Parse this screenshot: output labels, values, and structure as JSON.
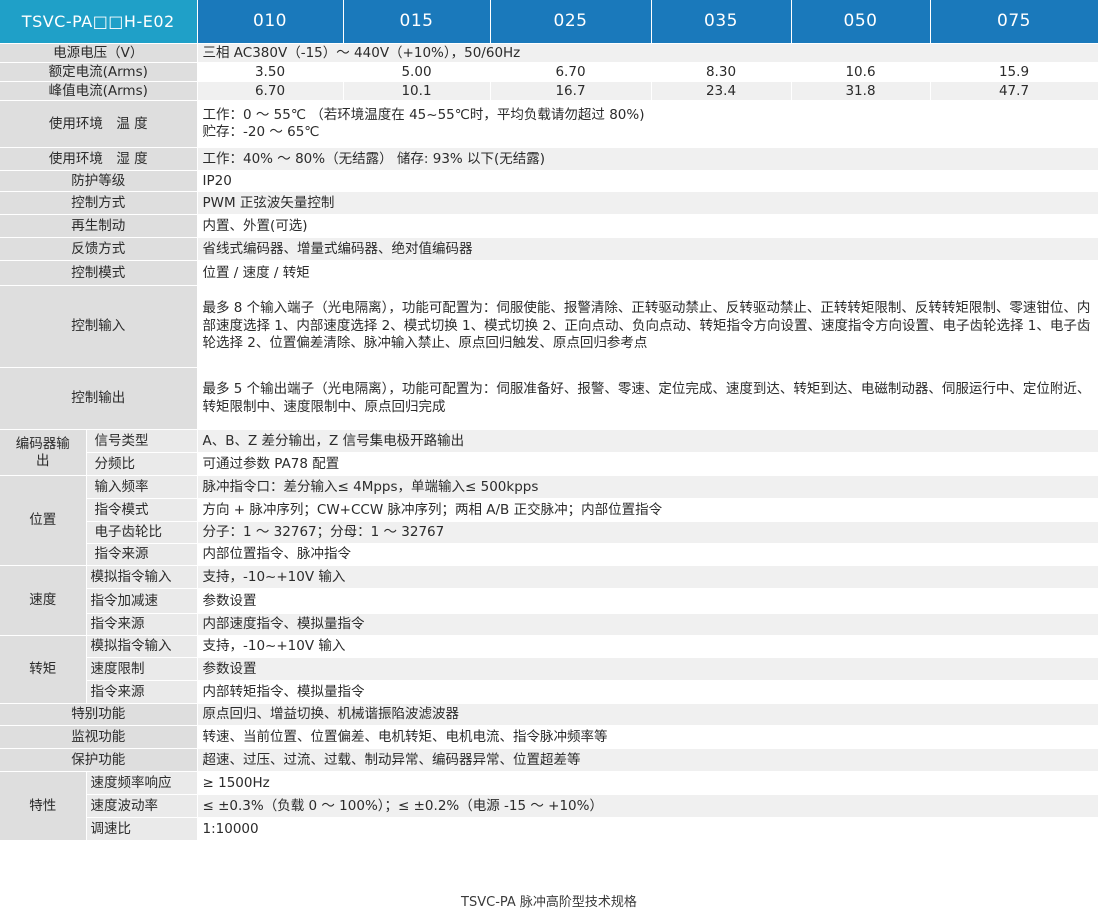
{
  "header": {
    "model": "TSVC-PA□□H-E02",
    "columns": [
      "010",
      "015",
      "025",
      "035",
      "050",
      "075"
    ]
  },
  "rows": {
    "voltage": {
      "label": "电源电压（V）",
      "value": "三相 AC380V（-15）～ 440V（+10%），50/60Hz"
    },
    "rated": {
      "label": "额定电流(Arms)",
      "values": [
        "3.50",
        "5.00",
        "6.70",
        "8.30",
        "10.6",
        "15.9"
      ]
    },
    "peak": {
      "label": "峰值电流(Arms)",
      "values": [
        "6.70",
        "10.1",
        "16.7",
        "23.4",
        "31.8",
        "47.7"
      ]
    },
    "temp": {
      "label": "使用环境　温 度",
      "line1": "工作：0 ～ 55℃ （若环境温度在 45~55℃时，平均负载请勿超过 80%)",
      "line2": "贮存：-20 ～ 65℃"
    },
    "humidity": {
      "label": "使用环境　湿 度",
      "value": "工作：40% ～ 80%（无结露） 储存: 93% 以下(无结露)"
    },
    "protection_class": {
      "label": "防护等级",
      "value": "IP20"
    },
    "control_method": {
      "label": "控制方式",
      "value": "PWM 正弦波矢量控制"
    },
    "regen": {
      "label": "再生制动",
      "value": "内置、外置(可选)"
    },
    "feedback": {
      "label": "反馈方式",
      "value": "省线式编码器、增量式编码器、绝对值编码器"
    },
    "control_mode": {
      "label": "控制模式",
      "value": "位置 / 速度 / 转矩"
    },
    "control_input": {
      "label": "控制输入",
      "value": "最多 8 个输入端子（光电隔离），功能可配置为：伺服使能、报警清除、正转驱动禁止、反转驱动禁止、正转转矩限制、反转转矩限制、零速钳位、内部速度选择 1、内部速度选择 2、模式切换 1、模式切换 2、正向点动、负向点动、转矩指令方向设置、速度指令方向设置、电子齿轮选择 1、电子齿轮选择 2、位置偏差清除、脉冲输入禁止、原点回归触发、原点回归参考点"
    },
    "control_output": {
      "label": "控制输出",
      "value": "最多 5 个输出端子（光电隔离），功能可配置为：伺服准备好、报警、零速、定位完成、速度到达、转矩到达、电磁制动器、伺服运行中、定位附近、转矩限制中、速度限制中、原点回归完成"
    },
    "encoder_out": {
      "group": "编码器输出",
      "signal": {
        "label": "信号类型",
        "value": "A、B、Z 差分输出，Z 信号集电极开路输出"
      },
      "divider": {
        "label": "分频比",
        "value": "可通过参数 PA78 配置"
      }
    },
    "position": {
      "group": "位置",
      "freq": {
        "label": "输入频率",
        "value": "脉冲指令口：差分输入≤ 4Mpps，单端输入≤ 500kpps"
      },
      "mode": {
        "label": "指令模式",
        "value": "方向 + 脉冲序列；CW+CCW 脉冲序列；两相 A/B 正交脉冲；内部位置指令"
      },
      "gear": {
        "label": "电子齿轮比",
        "value": "分子：1 ～ 32767；分母：1 ～ 32767"
      },
      "source": {
        "label": "指令来源",
        "value": "内部位置指令、脉冲指令"
      }
    },
    "speed": {
      "group": "速度",
      "analog": {
        "label": "模拟指令输入",
        "value": "支持，-10~+10V 输入"
      },
      "accel": {
        "label": "指令加减速",
        "value": "参数设置"
      },
      "source": {
        "label": "指令来源",
        "value": "内部速度指令、模拟量指令"
      }
    },
    "torque": {
      "group": "转矩",
      "analog": {
        "label": "模拟指令输入",
        "value": "支持，-10~+10V 输入"
      },
      "limit": {
        "label": "速度限制",
        "value": "参数设置"
      },
      "source": {
        "label": "指令来源",
        "value": "内部转矩指令、模拟量指令"
      }
    },
    "special": {
      "label": "特别功能",
      "value": "原点回归、增益切换、机械谐振陷波滤波器"
    },
    "monitor": {
      "label": "监视功能",
      "value": "转速、当前位置、位置偏差、电机转矩、电机电流、指令脉冲频率等"
    },
    "protect": {
      "label": "保护功能",
      "value": "超速、过压、过流、过载、制动异常、编码器异常、位置超差等"
    },
    "perf": {
      "group": "特性",
      "response": {
        "label": "速度频率响应",
        "value": "≥ 1500Hz"
      },
      "fluct": {
        "label": "速度波动率",
        "value": "≤ ±0.3%（负载 0 ～ 100%）；≤ ±0.2%（电源 -15 ～ +10%）"
      },
      "ratio": {
        "label": "调速比",
        "value": "1:10000"
      }
    }
  },
  "caption": "TSVC-PA 脉冲高阶型技术规格",
  "colors": {
    "header_model": "#1fa0c8",
    "header_cols": "#1a79bb",
    "label_bg": "#dedede",
    "row_alt": "#f0f0f0"
  }
}
